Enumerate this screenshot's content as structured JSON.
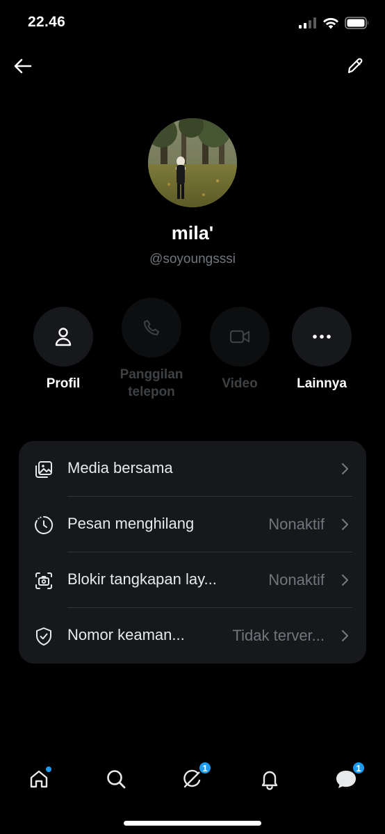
{
  "status_bar": {
    "time": "22.46"
  },
  "profile": {
    "display_name": "mila'",
    "handle": "@soyoungsssi"
  },
  "actions": [
    {
      "label": "Profil",
      "icon": "person-icon",
      "enabled": true
    },
    {
      "label": "Panggilan telepon",
      "icon": "phone-icon",
      "enabled": false
    },
    {
      "label": "Video",
      "icon": "video-camera-icon",
      "enabled": false
    },
    {
      "label": "Lainnya",
      "icon": "more-dots-icon",
      "enabled": true
    }
  ],
  "settings": [
    {
      "label": "Media bersama",
      "value": "",
      "icon": "shared-media-icon"
    },
    {
      "label": "Pesan menghilang",
      "value": "Nonaktif",
      "icon": "timer-icon"
    },
    {
      "label": "Blokir tangkapan lay...",
      "value": "Nonaktif",
      "icon": "screenshot-block-icon"
    },
    {
      "label": "Nomor keaman...",
      "value": "Tidak terver...",
      "icon": "shield-check-icon"
    }
  ],
  "bottom_nav": {
    "home_dot": true,
    "grok_badge": "1",
    "messages_badge": "1"
  },
  "colors": {
    "accent": "#1d9bf0",
    "card": "#16181c",
    "secondary_text": "#71767b"
  }
}
